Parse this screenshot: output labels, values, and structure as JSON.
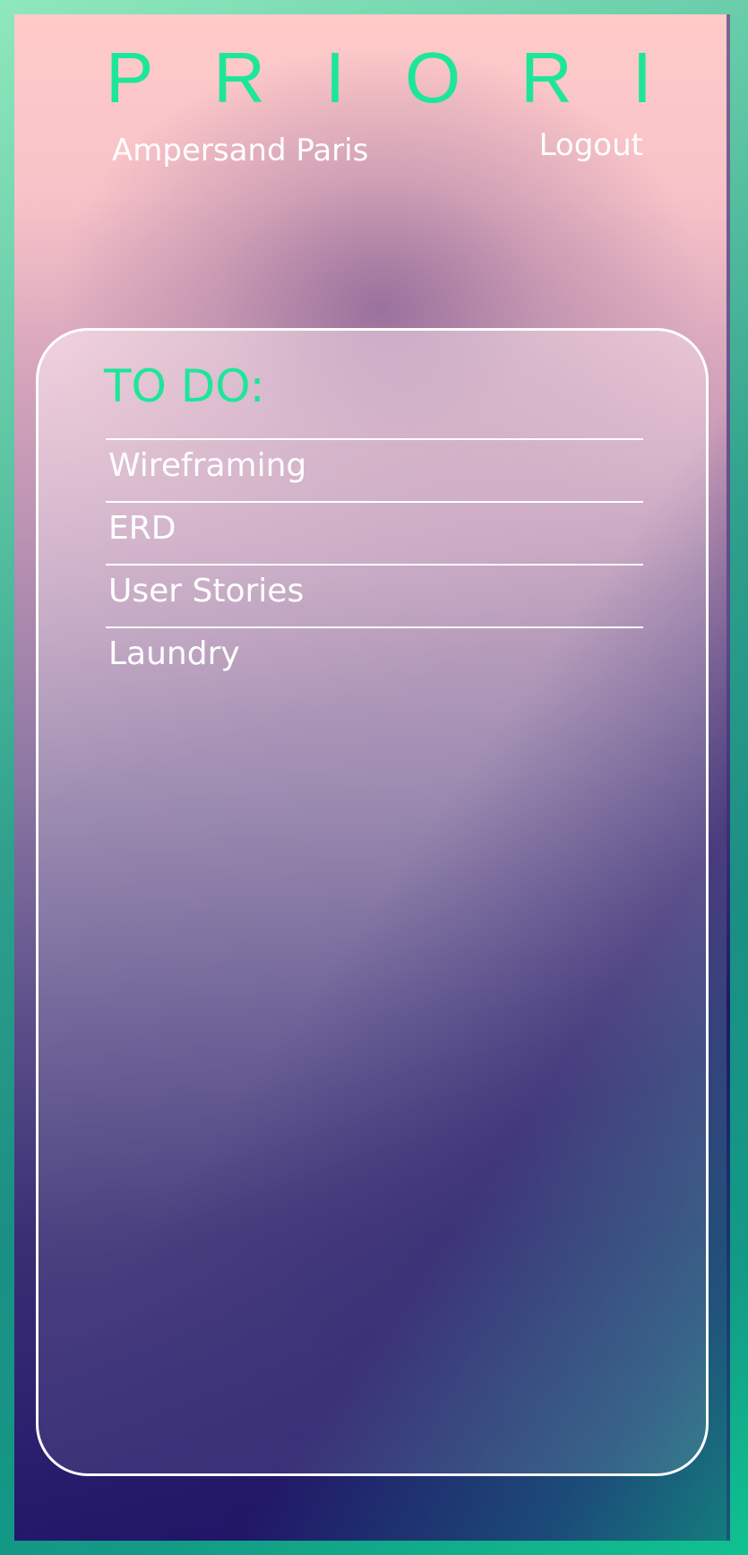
{
  "app": {
    "brand_letters": [
      "P",
      "R",
      "I",
      "O",
      "R",
      "I"
    ],
    "user_name": "Ampersand Paris",
    "logout_label": "Logout"
  },
  "todo": {
    "title": "TO DO:",
    "items": [
      {
        "label": "Wireframing"
      },
      {
        "label": "ERD"
      },
      {
        "label": "User Stories"
      },
      {
        "label": "Laundry"
      }
    ]
  },
  "colors": {
    "accent": "#1de69a",
    "text": "#ffffff"
  }
}
